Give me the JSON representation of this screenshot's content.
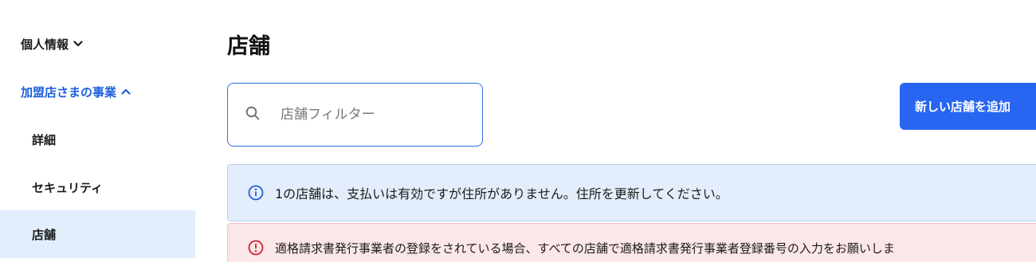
{
  "sidebar": {
    "items": [
      {
        "label": "個人情報",
        "expanded": false
      },
      {
        "label": "加盟店さまの事業",
        "expanded": true
      },
      {
        "label": "詳細"
      },
      {
        "label": "セキュリティ"
      },
      {
        "label": "店舗",
        "active": true
      }
    ]
  },
  "main": {
    "title": "店舗",
    "search": {
      "placeholder": "店舗フィルター",
      "value": ""
    },
    "add_button": "新しい店舗を追加",
    "info_banner": "1の店舗は、支払いは有効ですが住所がありません。住所を更新してください。",
    "warning_banner": "適格請求書発行事業者の登録をされている場合、すべての店舗で適格請求書発行事業者登録番号の入力をお願いしま"
  },
  "colors": {
    "accent": "#2866f2",
    "link": "#1f5fd9",
    "active_bg": "#e3eefc",
    "info_bg": "#e3edfb",
    "warn_bg": "#fbe6e8",
    "warn_icon": "#d0202e"
  }
}
